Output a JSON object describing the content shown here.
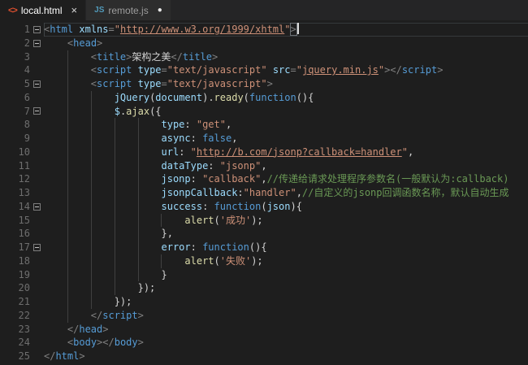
{
  "tab_bar": {
    "tabs": [
      {
        "label": "local.html",
        "icon_text": "<>",
        "close_label": "×",
        "active": true
      },
      {
        "label": "remote.js",
        "icon_text": "JS",
        "dirty_dot": "●",
        "active": false
      }
    ]
  },
  "editor": {
    "palette": {
      "punct": "#808080",
      "bracket": "#808080",
      "tag": "#569cd6",
      "attr": "#9cdcfe",
      "str": "#ce9178",
      "link": "#ce9178",
      "kw": "#569cd6",
      "fn": "#dcdcaa",
      "var": "#9cdcfe",
      "plain": "#d4d4d4",
      "comment": "#6a9955",
      "background": "#1e1e1e",
      "line_number": "#6e6e6e",
      "indent_guide": "#404040",
      "icon_html": "#e0502f",
      "icon_js": "#519aba"
    },
    "lines": [
      {
        "num": "1",
        "indent": 0,
        "fold": true,
        "current": true,
        "cursor": true,
        "tokens": [
          [
            "punct",
            "<"
          ],
          [
            "tag",
            "html"
          ],
          [
            "plain",
            " "
          ],
          [
            "attr",
            "xmlns"
          ],
          [
            "punct",
            "="
          ],
          [
            "str",
            "\""
          ],
          [
            "link",
            "http://www.w3.org/1999/xhtml"
          ],
          [
            "str",
            "\""
          ],
          [
            "bracket",
            ">"
          ]
        ]
      },
      {
        "num": "2",
        "indent": 4,
        "fold": true,
        "tokens": [
          [
            "punct",
            "<"
          ],
          [
            "tag",
            "head"
          ],
          [
            "punct",
            ">"
          ]
        ]
      },
      {
        "num": "3",
        "indent": 8,
        "tokens": [
          [
            "punct",
            "<"
          ],
          [
            "tag",
            "title"
          ],
          [
            "punct",
            ">"
          ],
          [
            "plain",
            "架构之美"
          ],
          [
            "punct",
            "</"
          ],
          [
            "tag",
            "title"
          ],
          [
            "punct",
            ">"
          ]
        ]
      },
      {
        "num": "4",
        "indent": 8,
        "tokens": [
          [
            "punct",
            "<"
          ],
          [
            "tag",
            "script"
          ],
          [
            "plain",
            " "
          ],
          [
            "attr",
            "type"
          ],
          [
            "punct",
            "="
          ],
          [
            "str",
            "\"text/javascript\""
          ],
          [
            "plain",
            " "
          ],
          [
            "attr",
            "src"
          ],
          [
            "punct",
            "="
          ],
          [
            "str",
            "\""
          ],
          [
            "link",
            "jquery.min.js"
          ],
          [
            "str",
            "\""
          ],
          [
            "punct",
            "></"
          ],
          [
            "tag",
            "script"
          ],
          [
            "punct",
            ">"
          ]
        ]
      },
      {
        "num": "5",
        "indent": 8,
        "fold": true,
        "tokens": [
          [
            "punct",
            "<"
          ],
          [
            "tag",
            "script"
          ],
          [
            "plain",
            " "
          ],
          [
            "attr",
            "type"
          ],
          [
            "punct",
            "="
          ],
          [
            "str",
            "\"text/javascript\""
          ],
          [
            "punct",
            ">"
          ]
        ]
      },
      {
        "num": "6",
        "indent": 12,
        "tokens": [
          [
            "var",
            "jQuery"
          ],
          [
            "plain",
            "("
          ],
          [
            "var",
            "document"
          ],
          [
            "plain",
            ")."
          ],
          [
            "fn",
            "ready"
          ],
          [
            "plain",
            "("
          ],
          [
            "kw",
            "function"
          ],
          [
            "plain",
            "(){"
          ]
        ]
      },
      {
        "num": "7",
        "indent": 12,
        "fold": true,
        "tokens": [
          [
            "var",
            "$"
          ],
          [
            "plain",
            "."
          ],
          [
            "fn",
            "ajax"
          ],
          [
            "plain",
            "({"
          ]
        ]
      },
      {
        "num": "8",
        "indent": 20,
        "tokens": [
          [
            "var",
            "type"
          ],
          [
            "plain",
            ": "
          ],
          [
            "str",
            "\"get\""
          ],
          [
            "plain",
            ","
          ]
        ]
      },
      {
        "num": "9",
        "indent": 20,
        "tokens": [
          [
            "var",
            "async"
          ],
          [
            "plain",
            ": "
          ],
          [
            "kw",
            "false"
          ],
          [
            "plain",
            ","
          ]
        ]
      },
      {
        "num": "10",
        "indent": 20,
        "tokens": [
          [
            "var",
            "url"
          ],
          [
            "plain",
            ": "
          ],
          [
            "str",
            "\""
          ],
          [
            "link",
            "http://b.com/jsonp?callback=handler"
          ],
          [
            "str",
            "\""
          ],
          [
            "plain",
            ","
          ]
        ]
      },
      {
        "num": "11",
        "indent": 20,
        "tokens": [
          [
            "var",
            "dataType"
          ],
          [
            "plain",
            ": "
          ],
          [
            "str",
            "\"jsonp\""
          ],
          [
            "plain",
            ","
          ]
        ]
      },
      {
        "num": "12",
        "indent": 20,
        "tokens": [
          [
            "var",
            "jsonp"
          ],
          [
            "plain",
            ": "
          ],
          [
            "str",
            "\"callback\""
          ],
          [
            "plain",
            ","
          ],
          [
            "comment",
            "//传递给请求处理程序参数名(一般默认为:callback)"
          ]
        ]
      },
      {
        "num": "13",
        "indent": 20,
        "tokens": [
          [
            "var",
            "jsonpCallback"
          ],
          [
            "plain",
            ":"
          ],
          [
            "str",
            "\"handler\""
          ],
          [
            "plain",
            ","
          ],
          [
            "comment",
            "//自定义的jsonp回调函数名称，默认自动生成"
          ]
        ]
      },
      {
        "num": "14",
        "indent": 20,
        "fold": true,
        "tokens": [
          [
            "var",
            "success"
          ],
          [
            "plain",
            ": "
          ],
          [
            "kw",
            "function"
          ],
          [
            "plain",
            "("
          ],
          [
            "var",
            "json"
          ],
          [
            "plain",
            "){"
          ]
        ]
      },
      {
        "num": "15",
        "indent": 24,
        "tokens": [
          [
            "fn",
            "alert"
          ],
          [
            "plain",
            "("
          ],
          [
            "str",
            "'成功'"
          ],
          [
            "plain",
            ");"
          ]
        ]
      },
      {
        "num": "16",
        "indent": 20,
        "tokens": [
          [
            "plain",
            "},"
          ]
        ]
      },
      {
        "num": "17",
        "indent": 20,
        "fold": true,
        "tokens": [
          [
            "var",
            "error"
          ],
          [
            "plain",
            ": "
          ],
          [
            "kw",
            "function"
          ],
          [
            "plain",
            "(){"
          ]
        ]
      },
      {
        "num": "18",
        "indent": 24,
        "tokens": [
          [
            "fn",
            "alert"
          ],
          [
            "plain",
            "("
          ],
          [
            "str",
            "'失败'"
          ],
          [
            "plain",
            ");"
          ]
        ]
      },
      {
        "num": "19",
        "indent": 20,
        "tokens": [
          [
            "plain",
            "}"
          ]
        ]
      },
      {
        "num": "20",
        "indent": 16,
        "tokens": [
          [
            "plain",
            "});"
          ]
        ]
      },
      {
        "num": "21",
        "indent": 12,
        "tokens": [
          [
            "plain",
            "});"
          ]
        ]
      },
      {
        "num": "22",
        "indent": 8,
        "tokens": [
          [
            "punct",
            "</"
          ],
          [
            "tag",
            "script"
          ],
          [
            "punct",
            ">"
          ]
        ]
      },
      {
        "num": "23",
        "indent": 4,
        "tokens": [
          [
            "punct",
            "</"
          ],
          [
            "tag",
            "head"
          ],
          [
            "punct",
            ">"
          ]
        ]
      },
      {
        "num": "24",
        "indent": 4,
        "tokens": [
          [
            "punct",
            "<"
          ],
          [
            "tag",
            "body"
          ],
          [
            "punct",
            "></"
          ],
          [
            "tag",
            "body"
          ],
          [
            "punct",
            ">"
          ]
        ]
      },
      {
        "num": "25",
        "indent": 0,
        "tokens": [
          [
            "punct",
            "</"
          ],
          [
            "tag",
            "html"
          ],
          [
            "punct",
            ">"
          ]
        ]
      }
    ]
  }
}
